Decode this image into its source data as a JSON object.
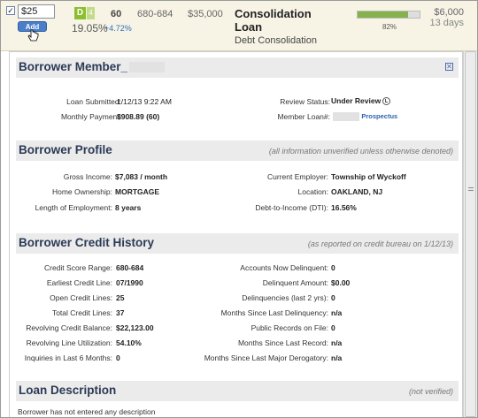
{
  "loan": {
    "invest_amount": "$25",
    "add_label": "Add",
    "grade": "D",
    "sub_grade": "4",
    "interest_rate": "19.05%",
    "rate_change": "+4.72%",
    "term": "60",
    "fico_range": "680-684",
    "loan_amount": "$35,000",
    "title": "Consolidation Loan",
    "purpose": "Debt Consolidation",
    "funded_percent": 0.82,
    "funded_label": "82%",
    "remaining_amount": "$6,000",
    "time_left": "13 days"
  },
  "member": {
    "heading": "Borrower Member_",
    "loan_submitted_label": "Loan Submitted:",
    "loan_submitted": "1/12/13 9:22 AM",
    "monthly_payment_label": "Monthly Payment:",
    "monthly_payment": "$908.89 (60)",
    "review_status_label": "Review Status:",
    "review_status": "Under Review",
    "member_loan_label": "Member Loan#:",
    "prospectus_label": "Prospectus"
  },
  "profile": {
    "heading": "Borrower Profile",
    "note": "(all information unverified unless otherwise denoted)",
    "gross_income_label": "Gross Income:",
    "gross_income": "$7,083 / month",
    "home_ownership_label": "Home Ownership:",
    "home_ownership": "MORTGAGE",
    "length_employment_label": "Length of Employment:",
    "length_employment": "8 years",
    "employer_label": "Current Employer:",
    "employer": "Township of Wyckoff",
    "location_label": "Location:",
    "location": "OAKLAND, NJ",
    "dti_label": "Debt-to-Income (DTI):",
    "dti": "16.56%"
  },
  "credit": {
    "heading": "Borrower Credit History",
    "note": "(as reported on credit bureau on 1/12/13)",
    "left": [
      {
        "label": "Credit Score Range:",
        "value": "680-684"
      },
      {
        "label": "Earliest Credit Line:",
        "value": "07/1990"
      },
      {
        "label": "Open Credit Lines:",
        "value": "25"
      },
      {
        "label": "Total Credit Lines:",
        "value": "37"
      },
      {
        "label": "Revolving Credit Balance:",
        "value": "$22,123.00"
      },
      {
        "label": "Revolving Line Utilization:",
        "value": "54.10%"
      },
      {
        "label": "Inquiries in Last 6 Months:",
        "value": "0"
      }
    ],
    "right": [
      {
        "label": "Accounts Now Delinquent:",
        "value": "0"
      },
      {
        "label": "Delinquent Amount:",
        "value": "$0.00"
      },
      {
        "label": "Delinquencies (last 2 yrs):",
        "value": "0"
      },
      {
        "label": "Months Since Last Delinquency:",
        "value": "n/a"
      },
      {
        "label": "Public Records on File:",
        "value": "0"
      },
      {
        "label": "Months Since Last Record:",
        "value": "n/a"
      },
      {
        "label": "Months Since Last Major Derogatory:",
        "value": "n/a"
      }
    ]
  },
  "description": {
    "heading": "Loan Description",
    "note": "(not verified)",
    "text": "Borrower has not entered any description"
  }
}
